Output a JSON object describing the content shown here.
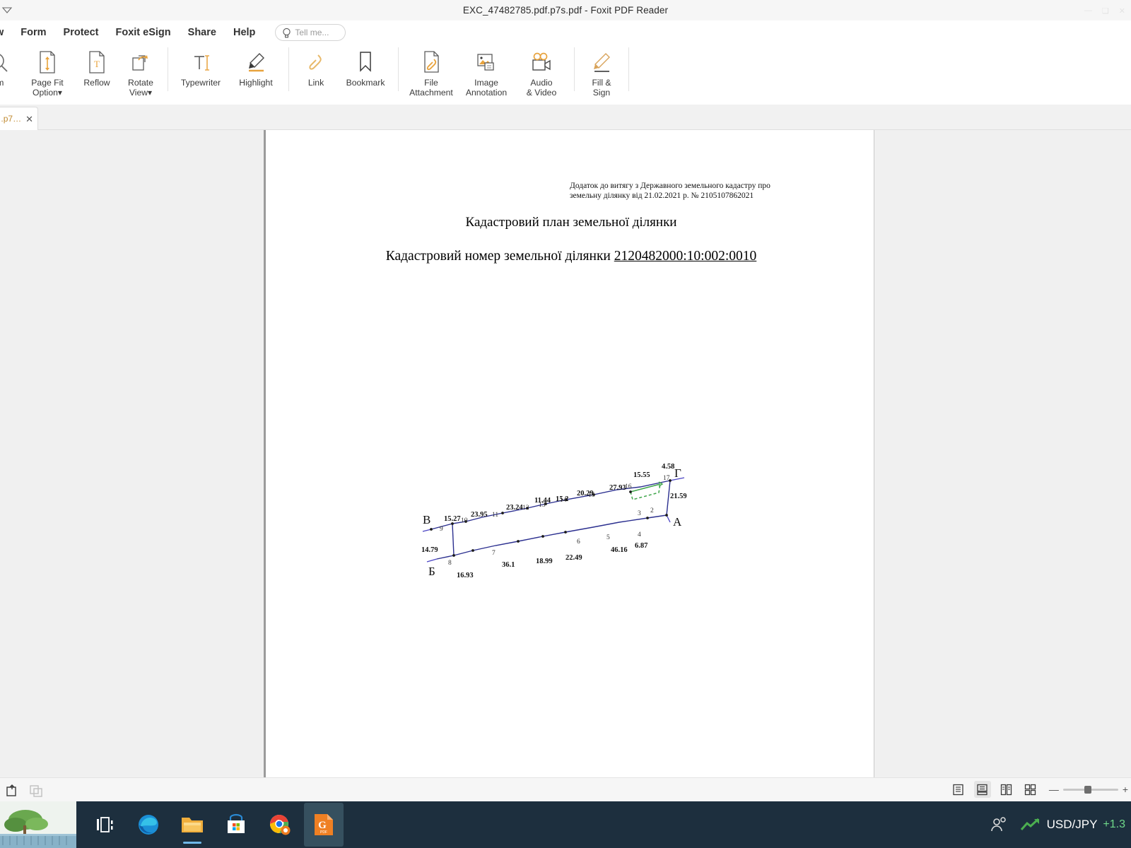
{
  "window": {
    "title": "EXC_47482785.pdf.p7s.pdf - Foxit PDF Reader",
    "minimize": "—",
    "maximize": "❑",
    "close": "✕"
  },
  "menubar": {
    "items": [
      {
        "label": "w",
        "name": "menu-view-truncated"
      },
      {
        "label": "Form",
        "name": "menu-form"
      },
      {
        "label": "Protect",
        "name": "menu-protect"
      },
      {
        "label": "Foxit eSign",
        "name": "menu-foxit-esign"
      },
      {
        "label": "Share",
        "name": "menu-share"
      },
      {
        "label": "Help",
        "name": "menu-help"
      }
    ],
    "tell_me_placeholder": "Tell me..."
  },
  "ribbon": {
    "buttons": [
      {
        "label": "om",
        "icon": "zoom-icon",
        "name": "zoom-button"
      },
      {
        "label": "Page Fit\nOption▾",
        "icon": "page-fit-icon",
        "name": "page-fit-option-button"
      },
      {
        "label": "Reflow",
        "icon": "reflow-icon",
        "name": "reflow-button"
      },
      {
        "label": "Rotate\nView▾",
        "icon": "rotate-view-icon",
        "name": "rotate-view-button"
      },
      {
        "label": "Typewriter",
        "icon": "typewriter-icon",
        "name": "typewriter-button"
      },
      {
        "label": "Highlight",
        "icon": "highlight-icon",
        "name": "highlight-button"
      },
      {
        "label": "Link",
        "icon": "link-icon",
        "name": "link-button"
      },
      {
        "label": "Bookmark",
        "icon": "bookmark-icon",
        "name": "bookmark-button"
      },
      {
        "label": "File\nAttachment",
        "icon": "file-attachment-icon",
        "name": "file-attachment-button"
      },
      {
        "label": "Image\nAnnotation",
        "icon": "image-annotation-icon",
        "name": "image-annotation-button"
      },
      {
        "label": "Audio\n& Video",
        "icon": "audio-video-icon",
        "name": "audio-video-button"
      },
      {
        "label": "Fill &\nSign",
        "icon": "fill-sign-icon",
        "name": "fill-sign-button"
      }
    ]
  },
  "doctab": {
    "label": ".p7…",
    "close": "✕"
  },
  "document": {
    "header_line_1": "Додаток до витягу з Державного земельного кадастру про",
    "header_line_2": "земельну ділянку від 21.02.2021 р. № 2105107862021",
    "title": "Кадастровий план земельної ділянки",
    "subtitle_prefix": "Кадастровий номер земельної ділянки ",
    "cadastral_number": "2120482000:10:002:0010"
  },
  "chart_data": {
    "type": "diagram",
    "title": "Кадастровий план земельної ділянки",
    "corner_labels": [
      "А",
      "Б",
      "В",
      "Г"
    ],
    "vertex_numbers": [
      "2",
      "3",
      "4",
      "5",
      "6",
      "7",
      "8",
      "9",
      "10",
      "11",
      "12",
      "13",
      "14",
      "15",
      "16",
      "17"
    ],
    "segment_lengths_top": [
      "15.27",
      "23.95",
      "23.24",
      "11.44",
      "15.2",
      "20.29",
      "27.93",
      "15.55",
      "4.58"
    ],
    "segment_lengths_bottom": [
      "16.93",
      "36.1",
      "18.99",
      "22.49",
      "46.16",
      "6.87"
    ],
    "segment_lengths_sides": [
      "14.79",
      "21.59"
    ],
    "boundary_color": "#2b2f8f",
    "annotation_color": "#3fa64a",
    "annotation_style": "dashed"
  },
  "statusbar": {
    "view_modes": [
      {
        "name": "single-page-view-icon",
        "active": false
      },
      {
        "name": "continuous-scroll-view-icon",
        "active": true
      },
      {
        "name": "two-page-view-icon",
        "active": false
      },
      {
        "name": "two-page-scroll-view-icon",
        "active": false
      }
    ],
    "zoom_out": "—",
    "zoom_in": "+"
  },
  "taskbar": {
    "icons": [
      {
        "name": "task-view-icon",
        "glyph": "task-view"
      },
      {
        "name": "microsoft-edge-icon",
        "glyph": "edge"
      },
      {
        "name": "file-explorer-icon",
        "glyph": "explorer"
      },
      {
        "name": "microsoft-store-icon",
        "glyph": "store"
      },
      {
        "name": "google-chrome-icon",
        "glyph": "chrome"
      },
      {
        "name": "foxit-pdf-reader-icon",
        "glyph": "pdf"
      }
    ],
    "people_icon": "people-icon",
    "stock_symbol": "USD/JPY",
    "stock_delta": "+1.3"
  }
}
